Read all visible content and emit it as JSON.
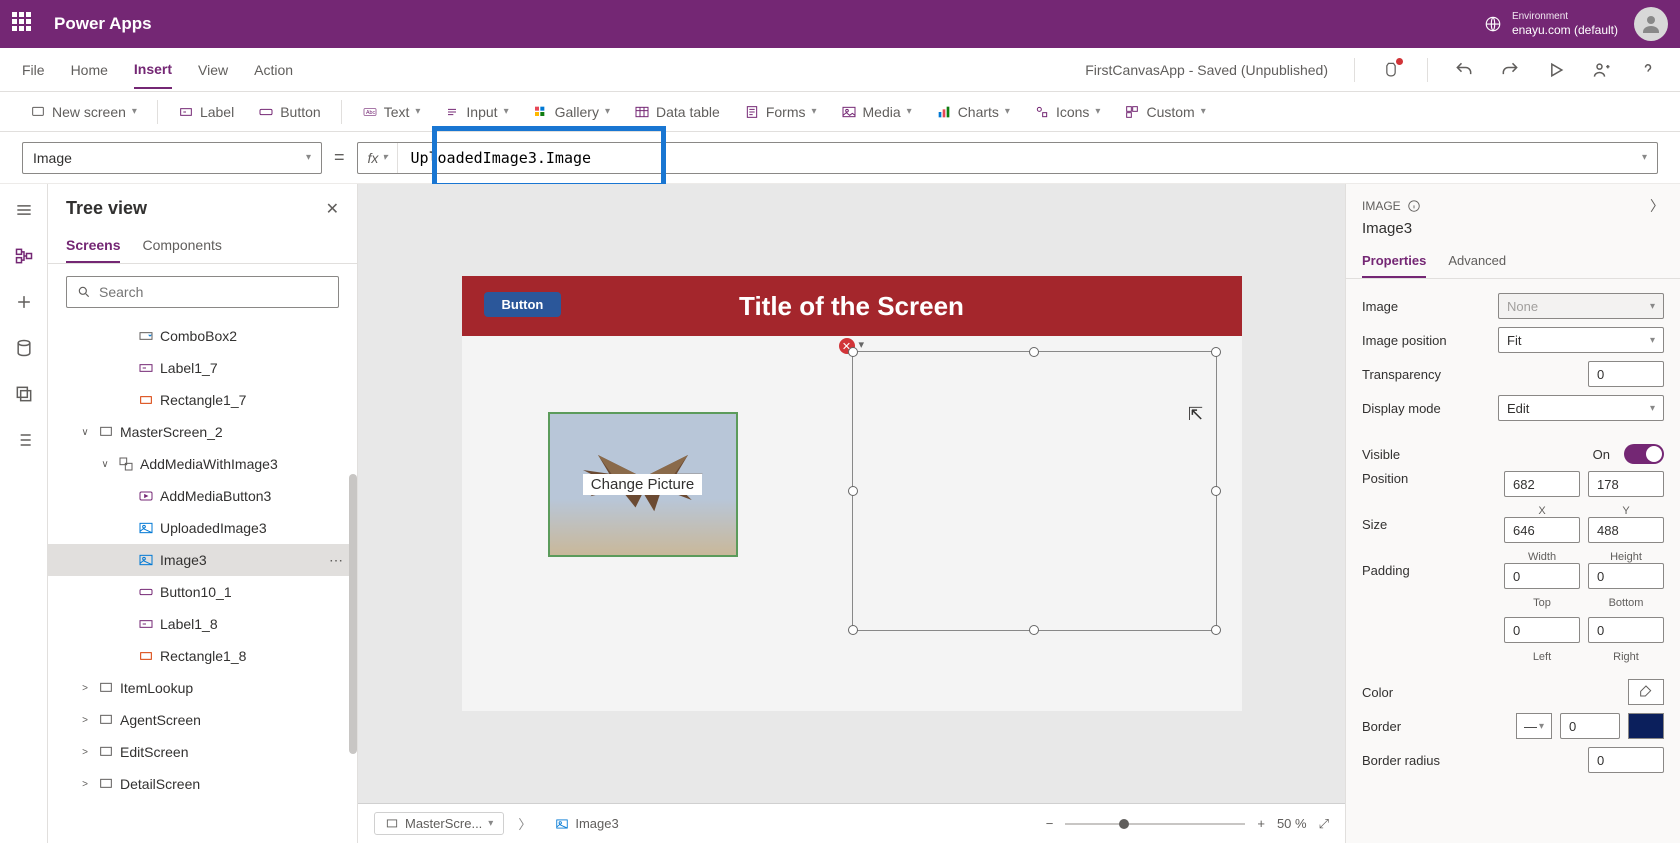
{
  "header": {
    "brand": "Power Apps",
    "env_label": "Environment",
    "env_value": "enayu.com (default)"
  },
  "menubar": {
    "items": [
      "File",
      "Home",
      "Insert",
      "View",
      "Action"
    ],
    "active": "Insert",
    "status": "FirstCanvasApp - Saved (Unpublished)"
  },
  "ribbon": {
    "new_screen": "New screen",
    "label": "Label",
    "button": "Button",
    "text": "Text",
    "input": "Input",
    "gallery": "Gallery",
    "data_table": "Data table",
    "forms": "Forms",
    "media": "Media",
    "charts": "Charts",
    "icons": "Icons",
    "custom": "Custom"
  },
  "formula": {
    "property": "Image",
    "expression": "UploadedImage3.Image"
  },
  "tree": {
    "title": "Tree view",
    "tabs": {
      "screens": "Screens",
      "components": "Components"
    },
    "search_placeholder": "Search",
    "items": [
      {
        "label": "ComboBox2",
        "icon": "combobox",
        "indent": 3
      },
      {
        "label": "Label1_7",
        "icon": "label",
        "indent": 3
      },
      {
        "label": "Rectangle1_7",
        "icon": "rect",
        "indent": 3
      },
      {
        "label": "MasterScreen_2",
        "icon": "screen",
        "indent": 1,
        "exp": "∨"
      },
      {
        "label": "AddMediaWithImage3",
        "icon": "group",
        "indent": 2,
        "exp": "∨"
      },
      {
        "label": "AddMediaButton3",
        "icon": "mediabtn",
        "indent": 3
      },
      {
        "label": "UploadedImage3",
        "icon": "image",
        "indent": 3
      },
      {
        "label": "Image3",
        "icon": "image",
        "indent": 3,
        "selected": true
      },
      {
        "label": "Button10_1",
        "icon": "button",
        "indent": 3
      },
      {
        "label": "Label1_8",
        "icon": "label",
        "indent": 3
      },
      {
        "label": "Rectangle1_8",
        "icon": "rect",
        "indent": 3
      },
      {
        "label": "ItemLookup",
        "icon": "screen",
        "indent": 1,
        "exp": ">"
      },
      {
        "label": "AgentScreen",
        "icon": "screen",
        "indent": 1,
        "exp": ">"
      },
      {
        "label": "EditScreen",
        "icon": "screen",
        "indent": 1,
        "exp": ">"
      },
      {
        "label": "DetailScreen",
        "icon": "screen",
        "indent": 1,
        "exp": ">"
      }
    ]
  },
  "canvas": {
    "screen_title": "Title of the Screen",
    "button_label": "Button",
    "media_label": "Change Picture",
    "breadcrumb_screen": "MasterScre...",
    "breadcrumb_control": "Image3",
    "zoom": "50  %"
  },
  "props": {
    "type": "IMAGE",
    "name": "Image3",
    "tabs": {
      "properties": "Properties",
      "advanced": "Advanced"
    },
    "image": {
      "label": "Image",
      "value": "None"
    },
    "image_position": {
      "label": "Image position",
      "value": "Fit"
    },
    "transparency": {
      "label": "Transparency",
      "value": "0"
    },
    "display_mode": {
      "label": "Display mode",
      "value": "Edit"
    },
    "visible": {
      "label": "Visible",
      "value": "On"
    },
    "position": {
      "label": "Position",
      "x": "682",
      "y": "178",
      "xl": "X",
      "yl": "Y"
    },
    "size": {
      "label": "Size",
      "w": "646",
      "h": "488",
      "wl": "Width",
      "hl": "Height"
    },
    "padding": {
      "label": "Padding",
      "top": "0",
      "bottom": "0",
      "left": "0",
      "right": "0",
      "tl": "Top",
      "bl": "Bottom",
      "ll": "Left",
      "rl": "Right"
    },
    "color": {
      "label": "Color"
    },
    "border": {
      "label": "Border",
      "value": "0"
    },
    "border_radius": {
      "label": "Border radius",
      "value": "0"
    }
  }
}
